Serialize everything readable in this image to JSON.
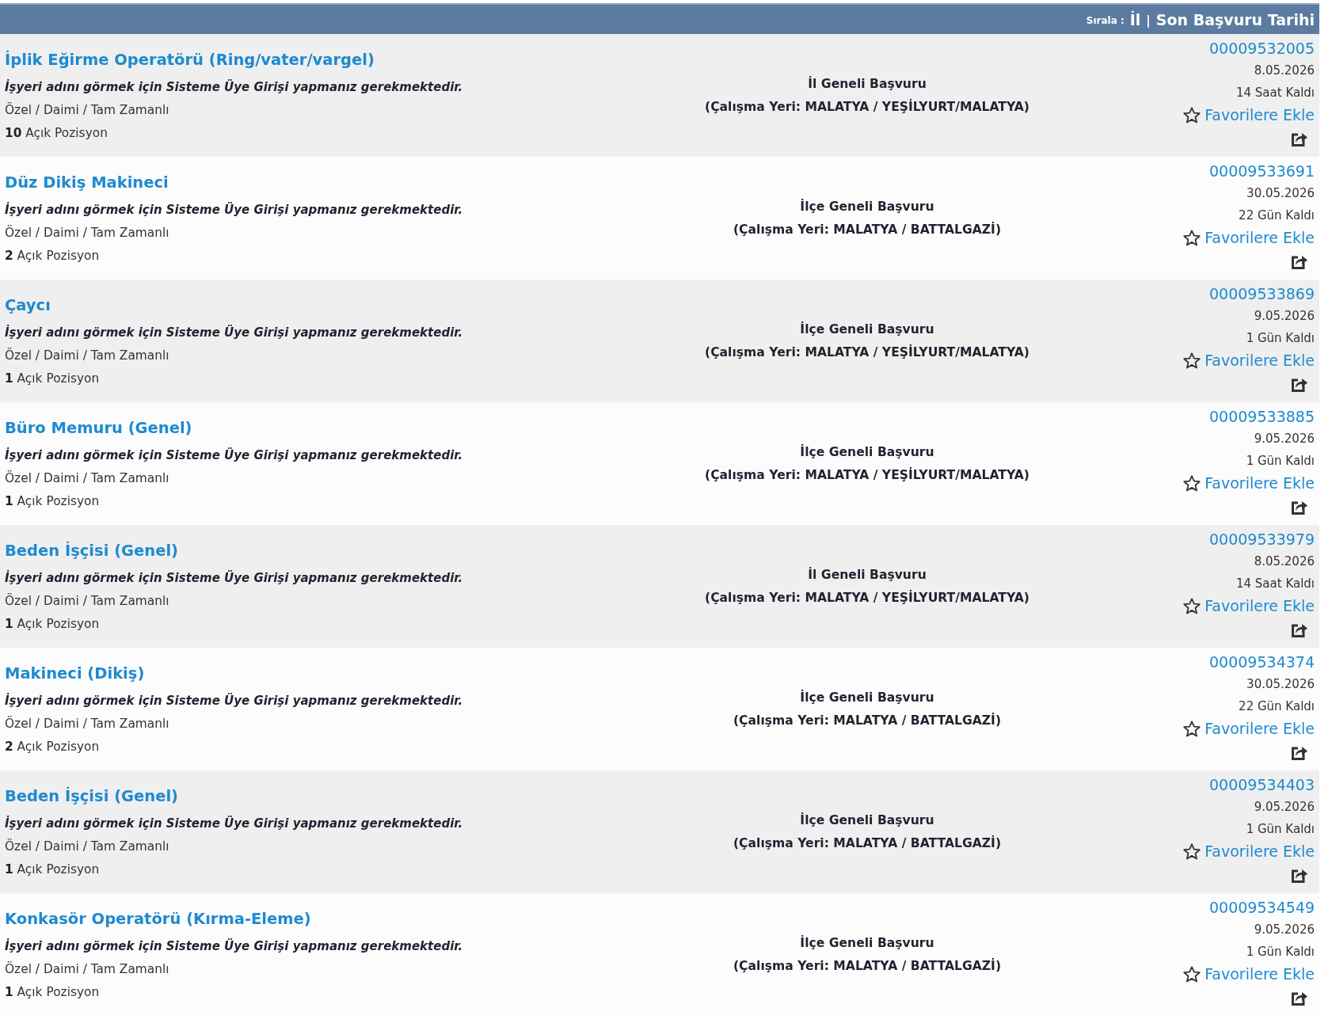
{
  "sort_bar": {
    "label": "Sırala :",
    "options": [
      {
        "label": "İl"
      },
      {
        "label": "Son Başvuru Tarihi"
      }
    ],
    "separator": "|"
  },
  "jobs": [
    {
      "title": "İplik Eğirme Operatörü (Ring/vater/vargel)",
      "employer_note": "İşyeri adını görmek için Sisteme Üye Girişi yapmanız gerekmektedir.",
      "type": "Özel / Daimi / Tam Zamanlı",
      "positions": "**10** Açık Pozisyon",
      "scope": "İl Geneli Başvuru",
      "location": "(Çalışma Yeri: MALATYA / YEŞİLYURT/MALATYA)",
      "id": "00009532005",
      "deadline": "8.05.2026",
      "remaining": "14 Saat Kaldı",
      "favorite_label": "Favorilere Ekle",
      "favorited": false
    },
    {
      "title": "Düz Dikiş Makineci",
      "employer_note": "İşyeri adını görmek için Sisteme Üye Girişi yapmanız gerekmektedir.",
      "type": "Özel / Daimi / Tam Zamanlı",
      "positions": "**2** Açık Pozisyon",
      "scope": "İlçe Geneli Başvuru",
      "location": "(Çalışma Yeri: MALATYA / BATTALGAZİ)",
      "id": "00009533691",
      "deadline": "30.05.2026",
      "remaining": "22 Gün Kaldı",
      "favorite_label": "Favorilere Ekle",
      "favorited": false
    },
    {
      "title": "Çaycı",
      "employer_note": "İşyeri adını görmek için Sisteme Üye Girişi yapmanız gerekmektedir.",
      "type": "Özel / Daimi / Tam Zamanlı",
      "positions": "**1** Açık Pozisyon",
      "scope": "İlçe Geneli Başvuru",
      "location": "(Çalışma Yeri: MALATYA / YEŞİLYURT/MALATYA)",
      "id": "00009533869",
      "deadline": "9.05.2026",
      "remaining": "1 Gün Kaldı",
      "favorite_label": "Favorilere Ekle",
      "favorited": false
    },
    {
      "title": "Büro Memuru (Genel)",
      "employer_note": "İşyeri adını görmek için Sisteme Üye Girişi yapmanız gerekmektedir.",
      "type": "Özel / Daimi / Tam Zamanlı",
      "positions": "**1** Açık Pozisyon",
      "scope": "İlçe Geneli Başvuru",
      "location": "(Çalışma Yeri: MALATYA / YEŞİLYURT/MALATYA)",
      "id": "00009533885",
      "deadline": "9.05.2026",
      "remaining": "1 Gün Kaldı",
      "favorite_label": "Favorilere Ekle",
      "favorited": false
    },
    {
      "title": "Beden İşçisi (Genel)",
      "employer_note": "İşyeri adını görmek için Sisteme Üye Girişi yapmanız gerekmektedir.",
      "type": "Özel / Daimi / Tam Zamanlı",
      "positions": "**1** Açık Pozisyon",
      "scope": "İl Geneli Başvuru",
      "location": "(Çalışma Yeri: MALATYA / YEŞİLYURT/MALATYA)",
      "id": "00009533979",
      "deadline": "8.05.2026",
      "remaining": "14 Saat Kaldı",
      "favorite_label": "Favorilere Ekle",
      "favorited": false
    },
    {
      "title": "Makineci (Dikiş)",
      "employer_note": "İşyeri adını görmek için Sisteme Üye Girişi yapmanız gerekmektedir.",
      "type": "Özel / Daimi / Tam Zamanlı",
      "positions": "**2** Açık Pozisyon",
      "scope": "İlçe Geneli Başvuru",
      "location": "(Çalışma Yeri: MALATYA / BATTALGAZİ)",
      "id": "00009534374",
      "deadline": "30.05.2026",
      "remaining": "22 Gün Kaldı",
      "favorite_label": "Favorilere Ekle",
      "favorited": false
    },
    {
      "title": "Beden İşçisi (Genel)",
      "employer_note": "İşyeri adını görmek için Sisteme Üye Girişi yapmanız gerekmektedir.",
      "type": "Özel / Daimi / Tam Zamanlı",
      "positions": "**1** Açık Pozisyon",
      "scope": "İlçe Geneli Başvuru",
      "location": "(Çalışma Yeri: MALATYA / BATTALGAZİ)",
      "id": "00009534403",
      "deadline": "9.05.2026",
      "remaining": "1 Gün Kaldı",
      "favorite_label": "Favorilere Ekle",
      "favorited": false
    },
    {
      "title": "Konkasör Operatörü (Kırma-Eleme)",
      "employer_note": "İşyeri adını görmek için Sisteme Üye Girişi yapmanız gerekmektedir.",
      "type": "Özel / Daimi / Tam Zamanlı",
      "positions": "**1** Açık Pozisyon",
      "scope": "İlçe Geneli Başvuru",
      "location": "(Çalışma Yeri: MALATYA / BATTALGAZİ)",
      "id": "00009534549",
      "deadline": "9.05.2026",
      "remaining": "1 Gün Kaldı",
      "favorite_label": "Favorilere Ekle",
      "favorited": false
    }
  ]
}
